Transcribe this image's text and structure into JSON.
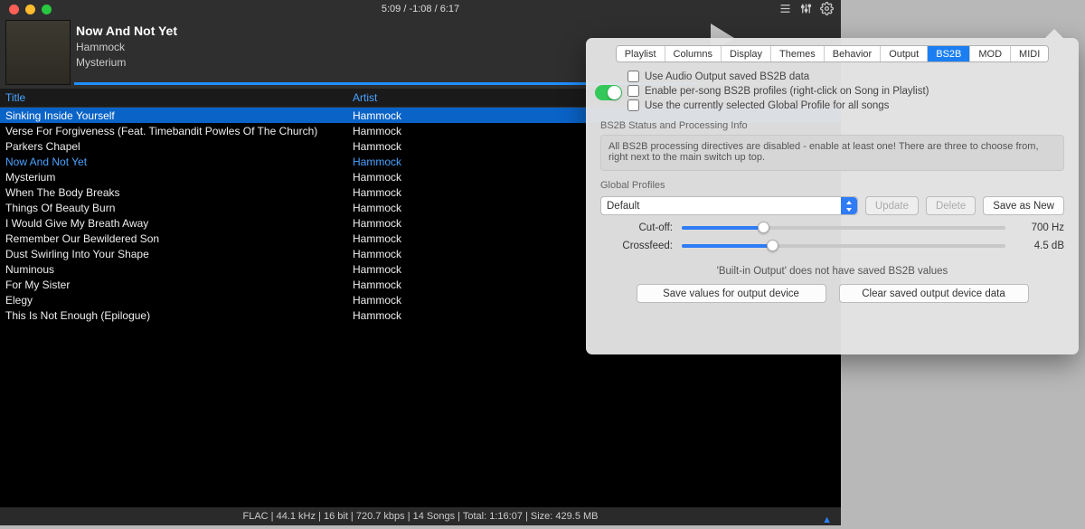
{
  "playback": {
    "time_readout": "5:09 / -1:08 / 6:17"
  },
  "now_playing": {
    "title": "Now And Not Yet",
    "artist": "Hammock",
    "album": "Mysterium"
  },
  "columns": {
    "title": "Title",
    "artist": "Artist"
  },
  "tracks": [
    {
      "title": "Sinking Inside Yourself",
      "artist": "Hammock",
      "selected": true
    },
    {
      "title": "Verse For Forgiveness (Feat. Timebandit Powles Of The Church)",
      "artist": "Hammock"
    },
    {
      "title": "Parkers Chapel",
      "artist": "Hammock"
    },
    {
      "title": "Now And Not Yet",
      "artist": "Hammock",
      "current": true
    },
    {
      "title": "Mysterium",
      "artist": "Hammock"
    },
    {
      "title": "When The Body Breaks",
      "artist": "Hammock"
    },
    {
      "title": "Things Of Beauty Burn",
      "artist": "Hammock"
    },
    {
      "title": "I Would Give My Breath Away",
      "artist": "Hammock"
    },
    {
      "title": "Remember Our Bewildered Son",
      "artist": "Hammock"
    },
    {
      "title": "Dust Swirling Into Your Shape",
      "artist": "Hammock"
    },
    {
      "title": "Numinous",
      "artist": "Hammock"
    },
    {
      "title": "For My Sister",
      "artist": "Hammock"
    },
    {
      "title": "Elegy",
      "artist": "Hammock"
    },
    {
      "title": "This Is Not Enough  (Epilogue)",
      "artist": "Hammock"
    }
  ],
  "statusbar": "FLAC | 44.1 kHz | 16 bit | 720.7 kbps | 14 Songs | Total: 1:16:07 | Size: 429.5 MB",
  "settings": {
    "tabs": [
      "Playlist",
      "Columns",
      "Display",
      "Themes",
      "Behavior",
      "Output",
      "BS2B",
      "MOD",
      "MIDI"
    ],
    "active_tab": "BS2B",
    "checks": {
      "use_saved": "Use Audio Output saved BS2B data",
      "per_song": "Enable per-song BS2B profiles (right-click on Song in Playlist)",
      "use_global": "Use the currently selected Global Profile for all songs"
    },
    "status_label": "BS2B Status and Processing Info",
    "status_text": "All BS2B processing directives are disabled - enable at least one! There are three to choose from, right next to the main switch up top.",
    "profiles_label": "Global Profiles",
    "profile_selected": "Default",
    "btn_update": "Update",
    "btn_delete": "Delete",
    "btn_save_new": "Save as New",
    "cutoff_label": "Cut-off:",
    "cutoff_value": "700 Hz",
    "crossfeed_label": "Crossfeed:",
    "crossfeed_value": "4.5 dB",
    "output_note": "'Built-in Output' does not have saved BS2B values",
    "btn_save_device": "Save values for output device",
    "btn_clear_device": "Clear saved output device data",
    "help": "?"
  }
}
